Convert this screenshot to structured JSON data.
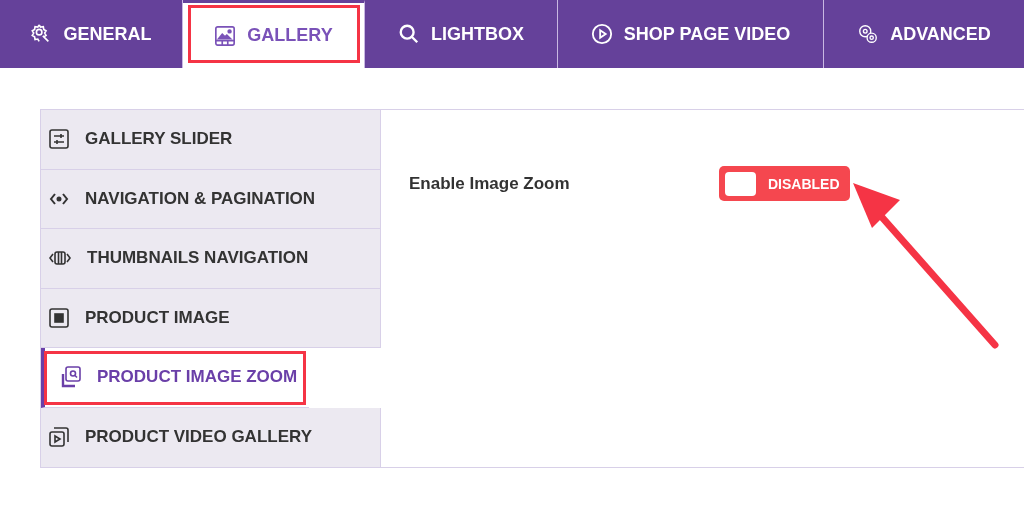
{
  "tabs": [
    {
      "label": "GENERAL",
      "selected": false,
      "highlighted": false
    },
    {
      "label": "GALLERY",
      "selected": true,
      "highlighted": true
    },
    {
      "label": "LIGHTBOX",
      "selected": false,
      "highlighted": false
    },
    {
      "label": "SHOP PAGE VIDEO",
      "selected": false,
      "highlighted": false
    },
    {
      "label": "ADVANCED",
      "selected": false,
      "highlighted": false
    }
  ],
  "sidebar": {
    "items": [
      {
        "label": "GALLERY SLIDER",
        "selected": false,
        "highlighted": false
      },
      {
        "label": "NAVIGATION & PAGINATION",
        "selected": false,
        "highlighted": false
      },
      {
        "label": "THUMBNAILS NAVIGATION",
        "selected": false,
        "highlighted": false
      },
      {
        "label": "PRODUCT IMAGE",
        "selected": false,
        "highlighted": false
      },
      {
        "label": "PRODUCT IMAGE ZOOM",
        "selected": true,
        "highlighted": true
      },
      {
        "label": "PRODUCT VIDEO GALLERY",
        "selected": false,
        "highlighted": false
      }
    ]
  },
  "settings": [
    {
      "label": "Enable Image Zoom",
      "toggle": {
        "on": false,
        "label": "DISABLED"
      }
    }
  ],
  "annotation": {
    "kind": "arrow"
  }
}
